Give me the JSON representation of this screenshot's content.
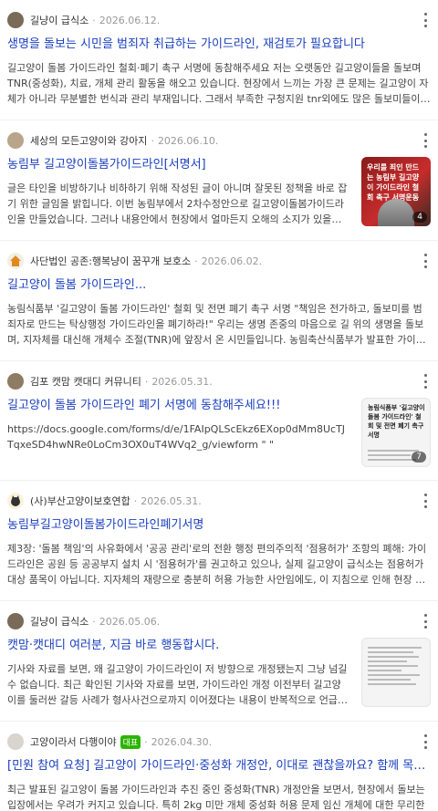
{
  "results": [
    {
      "source": "길냥이 급식소",
      "date": "2026.06.12.",
      "badge": "",
      "title": "생명을 돌보는 시민을 범죄자 취급하는 가이드라인, 재검토가 필요합니다",
      "desc": "길고양이 돌봄 가이드라인 철회·폐기 촉구 서명에 동참해주세요 저는 오랫동안 길고양이들을 돌보며 TNR(중성화), 치료, 개체 관리 활동을 해오고 있습니다. 현장에서 느끼는 가장 큰 문제는 길고양이 자체가 아니라 무분별한 번식과 관리 부재입니다. 그래서 부족한 구청지원 tnr외에도 많은 돌보미들이 자신의 시...",
      "thumb": null
    },
    {
      "source": "세상의 모든고양이와 강아지",
      "date": "2026.06.10.",
      "badge": "",
      "title": "농림부 길고양이돌봄가이드라인[서명서]",
      "desc": "글은 타인을 비방하기나 비하하기 위해 작성된 글이 아니며 잘못된 정책을 바로 잡기 위한 글임을 밝힙니다. 이번 농림부에서 2차수정안으로 길고양이돌봄가이드라인을 만들었습니다. 그러나 내용안에서 현장에서 얼마든지 오해의 소지가 있을법한 내용...",
      "thumb": {
        "kind": "photo",
        "text": "우리를 죄인 만드는 농림부 길고양이 가이드라인 철회 촉구 서명운동",
        "count": "4"
      }
    },
    {
      "source": "사단법인 공존:행복냥이 꿈꾸개 보호소",
      "date": "2026.06.02.",
      "badge": "",
      "title": "길고양이 돌봄 가이드라인...",
      "desc": "농림식품부 '길고양이 돌봄 가이드라인' 철회 및 전면 폐기 촉구 서명 \"책임은 전가하고, 돌보미를 범죄자로 만드는 탁상행정 가이드라인을 폐기하라!\" 우리는 생명 존중의 마음으로 길 위의 생명을 돌보며, 지자체를 대신해 개체수 조절(TNR)에 앞장서 온 시민들입니다. 농림축산식품부가 발표한 가이드라인은 현...",
      "thumb": null
    },
    {
      "source": "김포 캣맘 캣대디 커뮤니티",
      "date": "2026.05.31.",
      "badge": "",
      "title": "길고양이 돌봄 가이드라인 폐기 서명에 동참해주세요!!!",
      "desc": "https://docs.google.com/forms/d/e/1FAIpQLScEkz6EXop0dMm8UcTJTqxeSD4hwNRe0LoCm3OX0uT4WVq2_g/viewform \" \"",
      "thumb": {
        "kind": "doc",
        "text": "농림식품부 '길고양이 돌봄 가이드라인' 철회 및 전면 폐기 촉구 서명",
        "count": "7"
      }
    },
    {
      "source": "(사)부산고양이보호연합",
      "date": "2026.05.31.",
      "badge": "",
      "title": "농림부길고양이돌봄가이드라인폐기서명",
      "desc": "제3장: '돌봄 책임'의 사유화에서 '공공 관리'로의 전환 행정 편의주의적 '점용허가' 조항의 폐해: 가이드라인은 공원 등 공공부지 설치 시 '점용허가'를 권고하고 있으나, 실제 길고양이 급식소는 점용허가 대상 품목이 아닙니다. 지자체의 재량으로 충분히 허용 가능한 사안임에도, 이 지침으로 인해 현장 공무원들은...",
      "thumb": null
    },
    {
      "source": "길냥이 급식소",
      "date": "2026.05.06.",
      "badge": "",
      "title": "캣맘·캣대디 여러분, 지금 바로 행동합시다.",
      "desc": "기사와 자료를 보면, 왜 길고양이 가이드라인이 저 방향으로 개정됐는지 그냥 넘길 수 없습니다. 최근 확인된 기사와 자료를 보면, 가이드라인 개정 이전부터 길고양이를 둘러싼 갈등 사례가 형사사건으로까지 이어졌다는 내용이 반복적으로 언급되고 있습...",
      "thumb": {
        "kind": "text",
        "text": "",
        "count": ""
      }
    },
    {
      "source": "고양이라서 다행이야",
      "date": "2026.04.30.",
      "badge": "대표",
      "title": "[민원 참여 요청] 길고양이 가이드라인·중성화 개정안, 이대로 괜찮을까요? 함께 목소리 ...",
      "desc": "최근 발표된 길고양이 돌봄 가이드라인과 추진 중인 중성화(TNR) 개정안을 보면서, 현장에서 돌보는 입장에서는 우려가 커지고 있습니다. 특히 2kg 미만 개체 중성화 허용 문제 임신 개체에 대한 무리한 수술 가능성 사전 건강검사 없이 진행되는 현실과의 괴리 급식소 및 돌봄 활동이 위축될 수 있는 가이드라인 해석 ...",
      "thumb": null
    }
  ],
  "colors": {
    "title": "#1a3fbf",
    "meta": "#999999",
    "text": "#444444"
  }
}
